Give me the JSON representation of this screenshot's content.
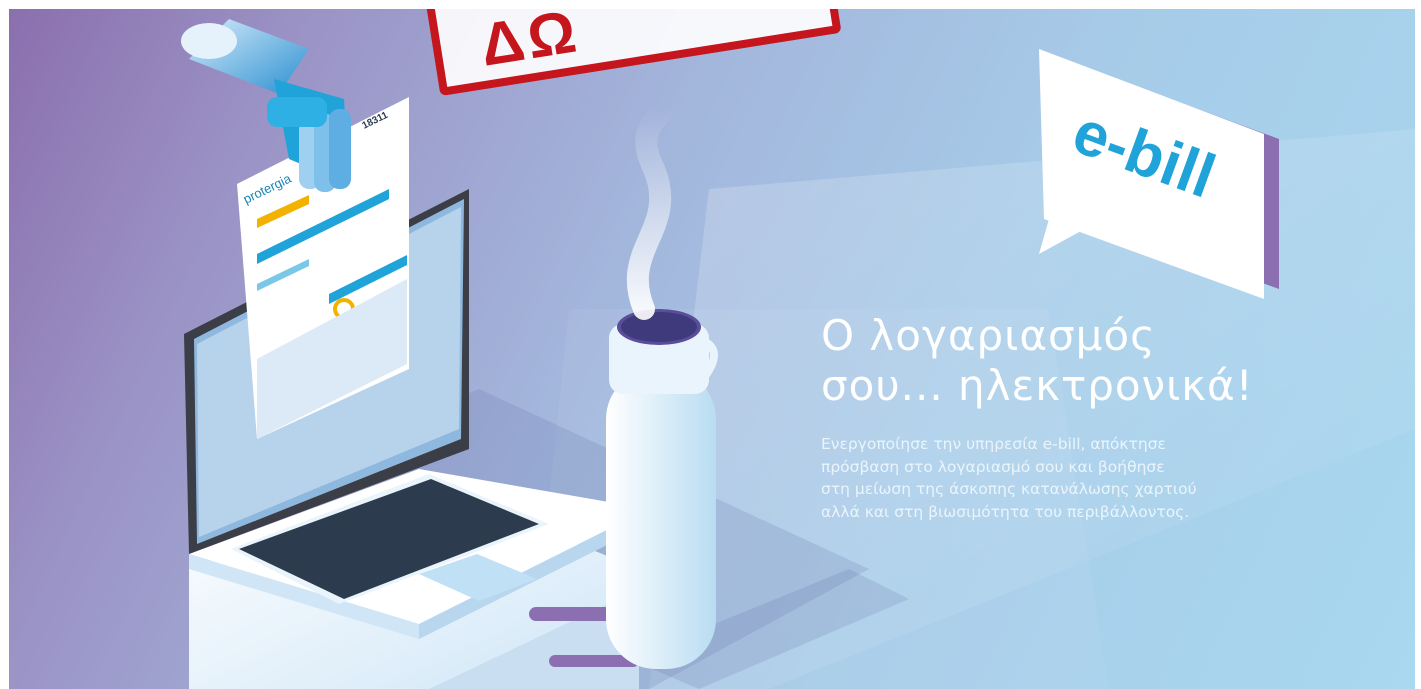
{
  "stamp": {
    "text": "ΔΩ"
  },
  "speech_bubble": {
    "label": "e-bill"
  },
  "bill_document": {
    "brand": "protergia",
    "phone": "18311"
  },
  "headline": {
    "line1": "Ο λογαριασμός",
    "line2": "σου... ηλεκτρονικά!"
  },
  "description": {
    "line1": "Ενεργοποίησε την υπηρεσία e-bill, απόκτησε",
    "line2": "πρόσβαση στο λογαριασμό σου και βοήθησε",
    "line3": "στη μείωση της άσκοπης κατανάλωσης χαρτιού",
    "line4": "αλλά και στη βιωσιμότητα του περιβάλλοντος."
  },
  "colors": {
    "brand_blue": "#1fa3d8",
    "stamp_red": "#c4161c",
    "accent_yellow": "#f2b300"
  },
  "icons": [
    "hand-icon",
    "laptop-icon",
    "thermos-icon",
    "speech-bubble-icon",
    "steam-icon"
  ]
}
